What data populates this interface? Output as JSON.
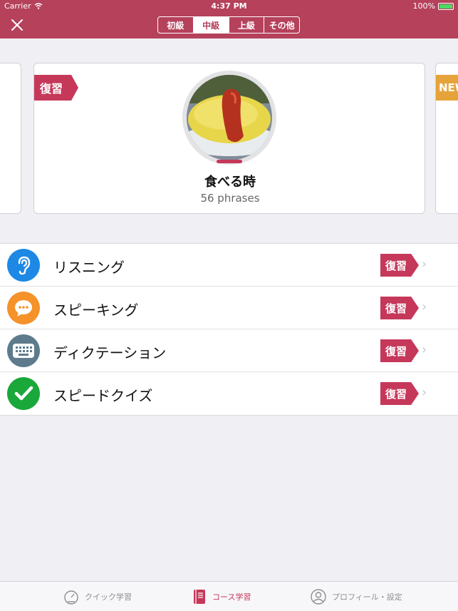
{
  "status_bar": {
    "carrier": "Carrier",
    "time": "4:37 PM",
    "battery": "100%"
  },
  "header": {
    "close_icon": "close-icon",
    "levels": [
      {
        "label": "初級",
        "active": false
      },
      {
        "label": "中級",
        "active": true
      },
      {
        "label": "上級",
        "active": false
      },
      {
        "label": "その他",
        "active": false
      }
    ]
  },
  "carousel": {
    "main": {
      "badge": "復習",
      "title": "食べる時",
      "subtitle": "56 phrases"
    },
    "next": {
      "badge": "NEW"
    }
  },
  "activities": [
    {
      "label": "リスニング",
      "icon": "ear-icon",
      "color": "#1e88e5",
      "badge": "復習"
    },
    {
      "label": "スピーキング",
      "icon": "speech-bubble-icon",
      "color": "#f5922a",
      "badge": "復習"
    },
    {
      "label": "ディクテーション",
      "icon": "keyboard-icon",
      "color": "#5d7b8c",
      "badge": "復習"
    },
    {
      "label": "スピードクイズ",
      "icon": "checkmark-icon",
      "color": "#1aa83a",
      "badge": "復習"
    }
  ],
  "tabbar": {
    "tabs": [
      {
        "label": "クイック学習",
        "icon": "speedometer-icon",
        "active": false
      },
      {
        "label": "コース学習",
        "icon": "book-icon",
        "active": true
      },
      {
        "label": "プロフィール・設定",
        "icon": "profile-icon",
        "active": false
      }
    ]
  },
  "colors": {
    "brand": "#b5415b",
    "badge_review": "#c6385a",
    "badge_new": "#e5a33a"
  }
}
